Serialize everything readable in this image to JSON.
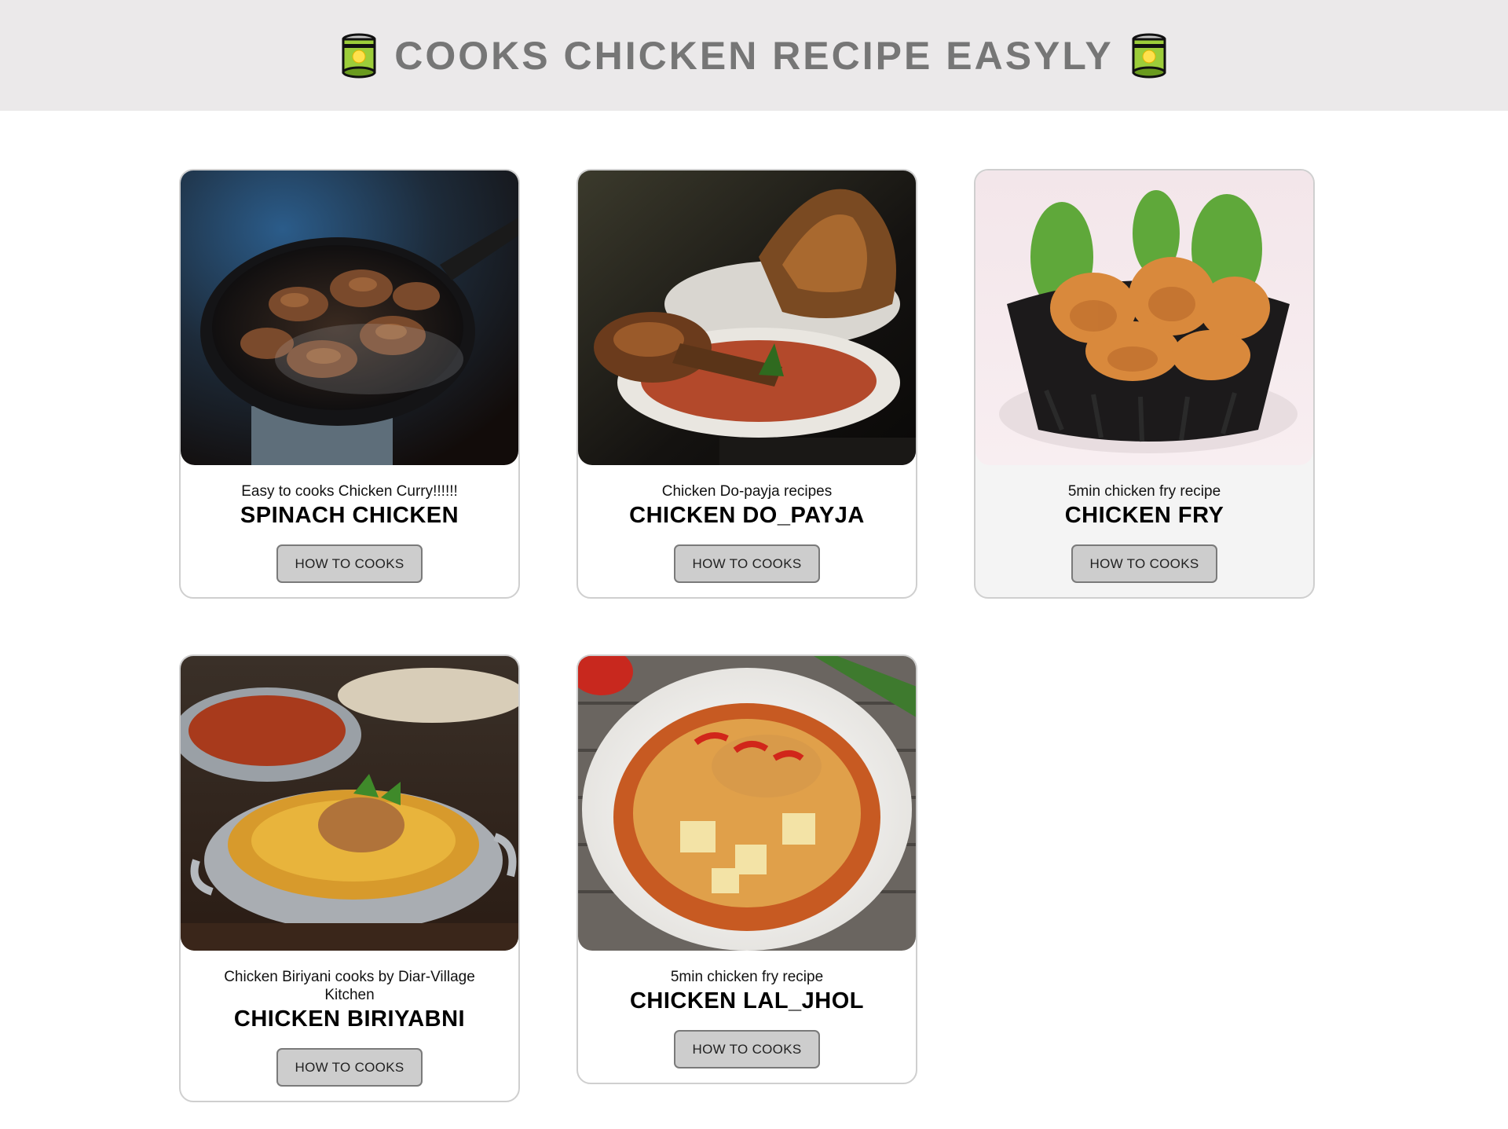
{
  "header": {
    "title": "COOKS CHICKEN RECIPE EASYLY",
    "left_icon": "canned-food-icon",
    "right_icon": "canned-food-icon"
  },
  "cards": [
    {
      "subtitle": "Easy to cooks Chicken Curry!!!!!!",
      "title": "SPINACH CHICKEN",
      "button": "HOW TO COOKS",
      "image": "chicken-curry-wok-photo"
    },
    {
      "subtitle": "Chicken Do-payja recipes",
      "title": "CHICKEN DO_PAYJA",
      "button": "HOW TO COOKS",
      "image": "roast-chicken-plate-photo"
    },
    {
      "subtitle": "5min chicken fry recipe",
      "title": "CHICKEN FRY",
      "button": "HOW TO COOKS",
      "image": "fried-chicken-basket-photo"
    },
    {
      "subtitle": "Chicken Biriyani cooks by Diar-Village Kitchen",
      "title": "CHICKEN BIRIYABNI",
      "button": "HOW TO COOKS",
      "image": "chicken-biryani-bowl-photo"
    },
    {
      "subtitle": "5min chicken fry recipe",
      "title": "CHICKEN LAL_JHOL",
      "button": "HOW TO COOKS",
      "image": "chicken-curry-bowl-photo"
    }
  ],
  "colors": {
    "header_bg": "#ebe9ea",
    "title_text": "#767676",
    "button_bg": "#cdcdcd",
    "card_border": "#cfcfcf"
  }
}
